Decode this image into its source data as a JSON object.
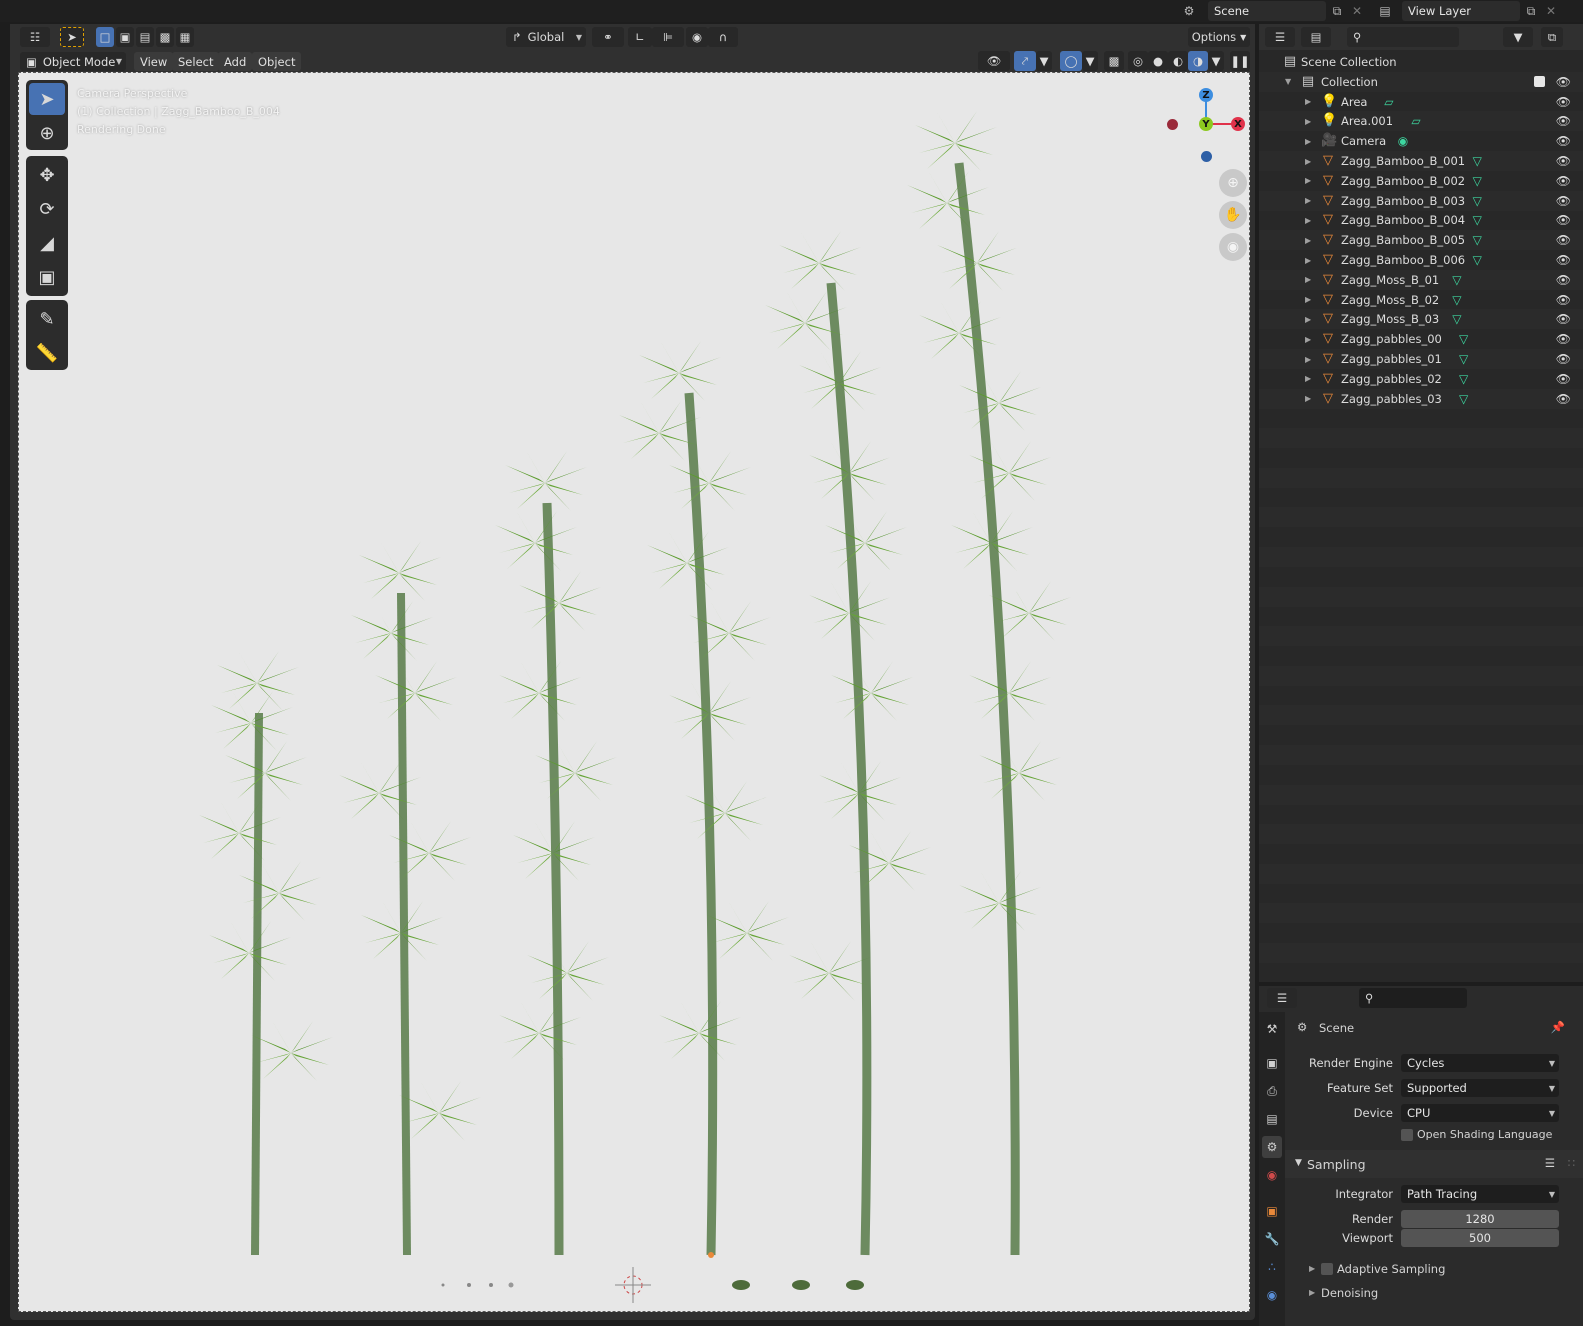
{
  "topbar": {
    "scene": "Scene",
    "view_layer": "View Layer"
  },
  "viewport": {
    "header": {
      "transform_orientation": "Global",
      "options": "Options"
    },
    "mode": "Object Mode",
    "menus": [
      "View",
      "Select",
      "Add",
      "Object"
    ],
    "overlay": {
      "line1": "Camera Perspective",
      "line2": "(1) Collection | Zagg_Bamboo_B_004",
      "line3": "Rendering Done"
    },
    "gizmo": {
      "z": "Z",
      "y": "Y",
      "x": "X"
    }
  },
  "outliner": {
    "root": "Scene Collection",
    "collection": "Collection",
    "items": [
      {
        "name": "Area",
        "type": "light"
      },
      {
        "name": "Area.001",
        "type": "light"
      },
      {
        "name": "Camera",
        "type": "camera"
      },
      {
        "name": "Zagg_Bamboo_B_001",
        "type": "mesh"
      },
      {
        "name": "Zagg_Bamboo_B_002",
        "type": "mesh"
      },
      {
        "name": "Zagg_Bamboo_B_003",
        "type": "mesh"
      },
      {
        "name": "Zagg_Bamboo_B_004",
        "type": "mesh"
      },
      {
        "name": "Zagg_Bamboo_B_005",
        "type": "mesh"
      },
      {
        "name": "Zagg_Bamboo_B_006",
        "type": "mesh"
      },
      {
        "name": "Zagg_Moss_B_01",
        "type": "mesh"
      },
      {
        "name": "Zagg_Moss_B_02",
        "type": "mesh"
      },
      {
        "name": "Zagg_Moss_B_03",
        "type": "mesh"
      },
      {
        "name": "Zagg_pabbles_00",
        "type": "mesh"
      },
      {
        "name": "Zagg_pabbles_01",
        "type": "mesh"
      },
      {
        "name": "Zagg_pabbles_02",
        "type": "mesh"
      },
      {
        "name": "Zagg_pabbles_03",
        "type": "mesh"
      }
    ]
  },
  "properties": {
    "context": "Scene",
    "render_engine_label": "Render Engine",
    "render_engine": "Cycles",
    "feature_set_label": "Feature Set",
    "feature_set": "Supported",
    "device_label": "Device",
    "device": "CPU",
    "osl_label": "Open Shading Language",
    "sampling_label": "Sampling",
    "integrator_label": "Integrator",
    "integrator": "Path Tracing",
    "render_label": "Render",
    "render_samples": "1280",
    "viewport_label": "Viewport",
    "viewport_samples": "500",
    "adaptive_label": "Adaptive Sampling",
    "denoising_label": "Denoising"
  },
  "colors": {
    "accent": "#4772b3",
    "object_orange": "#e9893a",
    "data_green": "#3dd7a0",
    "axis_x": "#e0324a",
    "axis_y": "#8cc920",
    "axis_z": "#3d8ee0"
  }
}
